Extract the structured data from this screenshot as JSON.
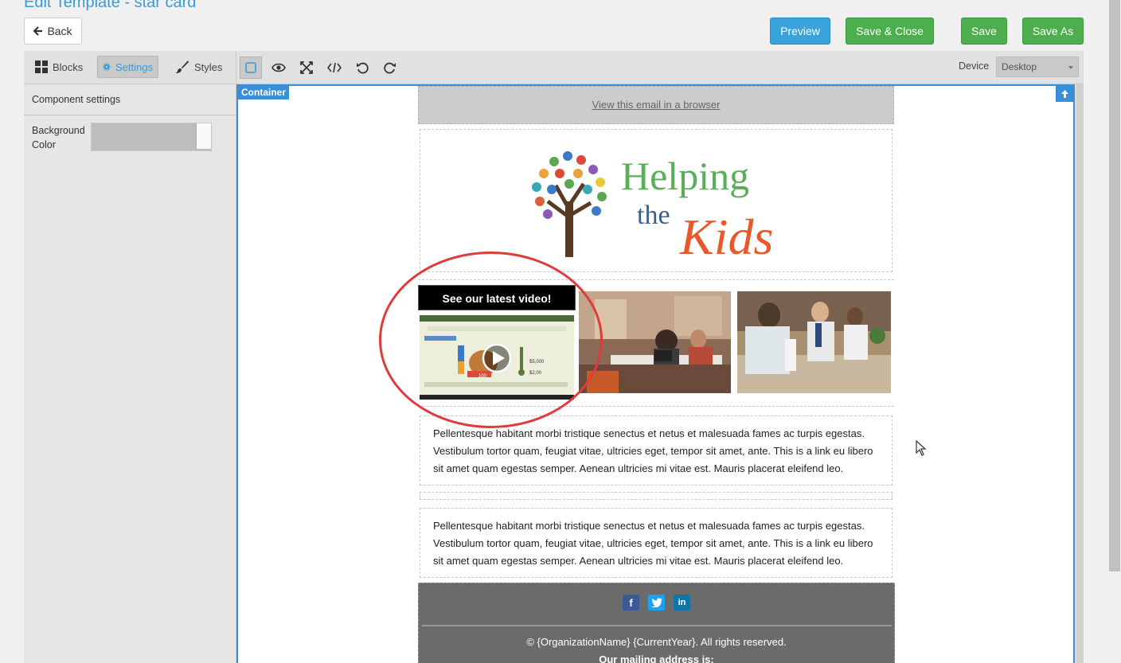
{
  "page": {
    "title": "Edit Template - star card"
  },
  "header": {
    "back_label": "Back",
    "preview_label": "Preview",
    "save_close_label": "Save & Close",
    "save_label": "Save",
    "save_as_label": "Save As"
  },
  "left_panel": {
    "tabs": [
      {
        "label": "Blocks",
        "icon": "grid-icon"
      },
      {
        "label": "Settings",
        "icon": "gear-icon",
        "active": true
      },
      {
        "label": "Styles",
        "icon": "brush-icon"
      }
    ],
    "section_title": "Component settings",
    "background_color_label": "Background Color",
    "background_color_value": "#bdbdbd"
  },
  "toolbar": {
    "tools": [
      "square-outline-icon",
      "eye-icon",
      "fullscreen-icon",
      "code-icon",
      "undo-icon",
      "redo-icon"
    ],
    "device_label": "Device",
    "device_value": "Desktop"
  },
  "canvas": {
    "container_tag": "Container"
  },
  "email": {
    "view_in_browser": "View this email in a browser",
    "logo": {
      "line1": "Helping",
      "line2a": "the",
      "line2b": "Kids"
    },
    "video_title": "See our latest video!",
    "video_thumb_text": {
      "amount1": "$5,000",
      "amount2": "$2,00",
      "counter": "100"
    },
    "paragraph1": "Pellentesque habitant morbi tristique senectus et netus et malesuada fames ac turpis egestas. Vestibulum tortor quam, feugiat vitae, ultricies eget, tempor sit amet, ante. This is a link eu libero sit amet quam egestas semper. Aenean ultricies mi vitae est. Mauris placerat eleifend leo.",
    "paragraph2": "Pellentesque habitant morbi tristique senectus et netus et malesuada fames ac turpis egestas. Vestibulum tortor quam, feugiat vitae, ultricies eget, tempor sit amet, ante. This is a link eu libero sit amet quam egestas semper. Aenean ultricies mi vitae est. Mauris placerat eleifend leo.",
    "social": [
      "facebook-icon",
      "twitter-icon",
      "linkedin-icon"
    ],
    "copyright": "© {OrganizationName} {CurrentYear}. All rights reserved.",
    "mailing": "Our mailing address is:"
  },
  "colors": {
    "accent": "#3a9ad9",
    "success": "#4cae4c",
    "highlight": "#e03b3b"
  }
}
